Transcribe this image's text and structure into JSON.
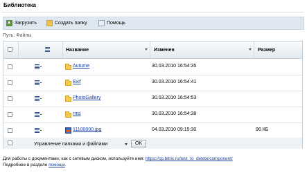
{
  "title": "Библиотека",
  "toolbar": {
    "upload_label": "Загрузить",
    "create_folder_label": "Создать папку",
    "help_label": "Помощь"
  },
  "path": "Путь: Файлы",
  "table": {
    "headers": {
      "name": "Название",
      "modified": "Изменен",
      "size": "Размер"
    },
    "rows": [
      {
        "name": "Autume",
        "type": "folder",
        "modified": "30.03.2010 16:54:35",
        "size": ""
      },
      {
        "name": "Exif",
        "type": "folder",
        "modified": "30.03.2010 16:54:41",
        "size": ""
      },
      {
        "name": "PhotoGallery",
        "type": "folder",
        "modified": "30.03.2010 16:54:53",
        "size": ""
      },
      {
        "name": "rms",
        "type": "folder",
        "modified": "30.03.2010 16:54:38",
        "size": ""
      },
      {
        "name": "11100000.jpg",
        "type": "image",
        "modified": "04.03.2010 09:15:30",
        "size": "96 КБ"
      }
    ]
  },
  "footer": {
    "action_select": "Управление папками и файлами",
    "ok_label": "OK"
  },
  "note": {
    "text_before": "Для работы с документами, как с сетевым диском, используйте имя:",
    "link": "https://cp.bitrix.ru/test_to_delete/component/",
    "line2_before": "Подробнее в разделе",
    "help_link": "помощи",
    "line2_after": "."
  },
  "colors": {
    "link": "#1c3fa0",
    "toolbar_bg": "#dfe8f0",
    "folder": "#f3cb4e"
  }
}
